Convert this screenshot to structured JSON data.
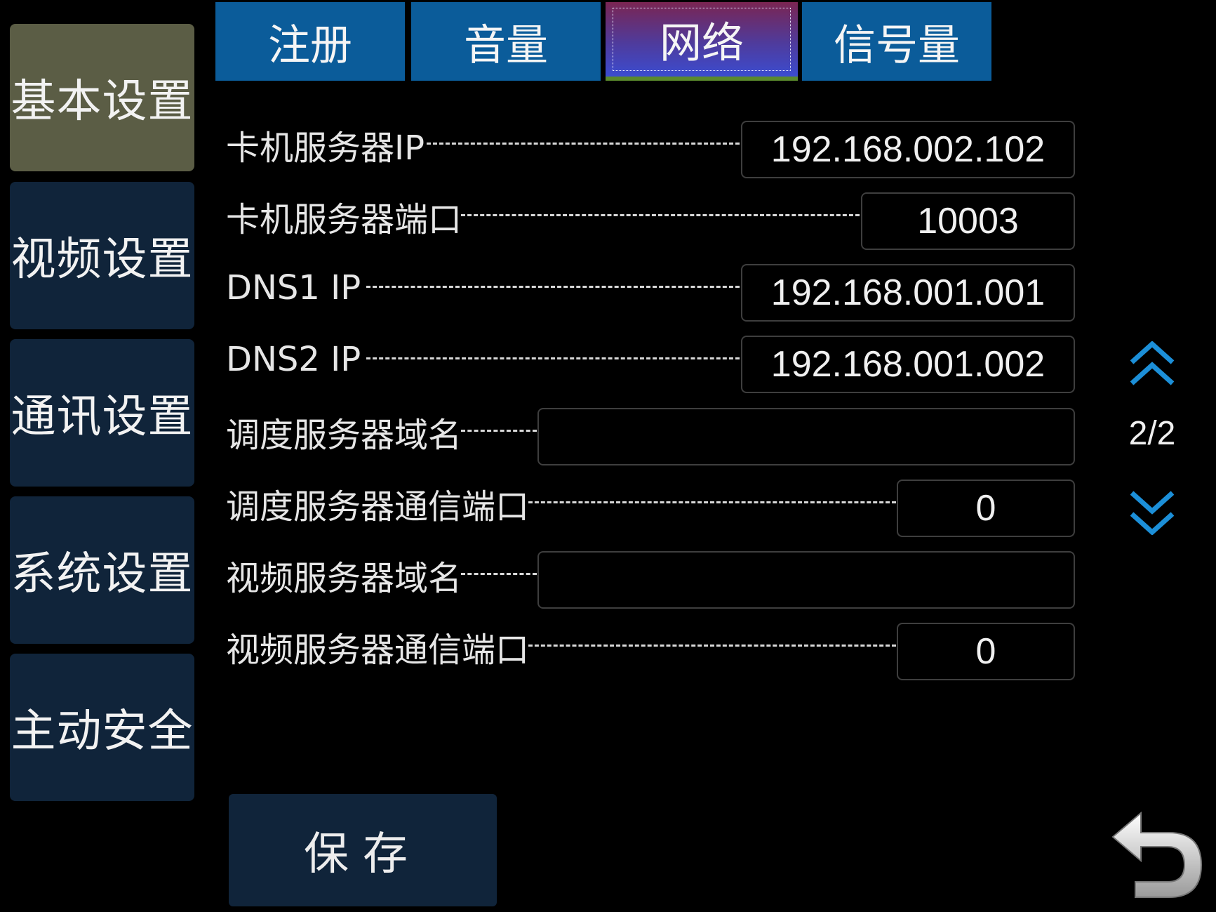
{
  "sidebar": {
    "items": [
      {
        "label": "基本设置",
        "active": true
      },
      {
        "label": "视频设置",
        "active": false
      },
      {
        "label": "通讯设置",
        "active": false
      },
      {
        "label": "系统设置",
        "active": false
      },
      {
        "label": "主动安全",
        "active": false
      }
    ]
  },
  "tabs": [
    {
      "label": "注册",
      "active": false
    },
    {
      "label": "音量",
      "active": false
    },
    {
      "label": "网络",
      "active": true
    },
    {
      "label": "信号量",
      "active": false
    }
  ],
  "form": {
    "rows": [
      {
        "label": "卡机服务器IP",
        "value": "192.168.002.102"
      },
      {
        "label": "卡机服务器端口",
        "value": "10003"
      },
      {
        "label": "DNS1 IP",
        "value": "192.168.001.001"
      },
      {
        "label": "DNS2 IP",
        "value": "192.168.001.002"
      },
      {
        "label": "调度服务器域名",
        "value": ""
      },
      {
        "label": "调度服务器通信端口",
        "value": "0"
      },
      {
        "label": "视频服务器域名",
        "value": ""
      },
      {
        "label": "视频服务器通信端口",
        "value": "0"
      }
    ]
  },
  "pager": {
    "text": "2/2"
  },
  "save_button": {
    "label": "保存"
  },
  "icons": {
    "page_up": "double-chevron-up-icon",
    "page_down": "double-chevron-down-icon",
    "back": "return-arrow-icon"
  },
  "colors": {
    "sidebar_active": "#5b5d45",
    "sidebar_inactive": "#10243a",
    "tab": "#0b5c9a",
    "pager_arrow": "#1c8fd8"
  }
}
